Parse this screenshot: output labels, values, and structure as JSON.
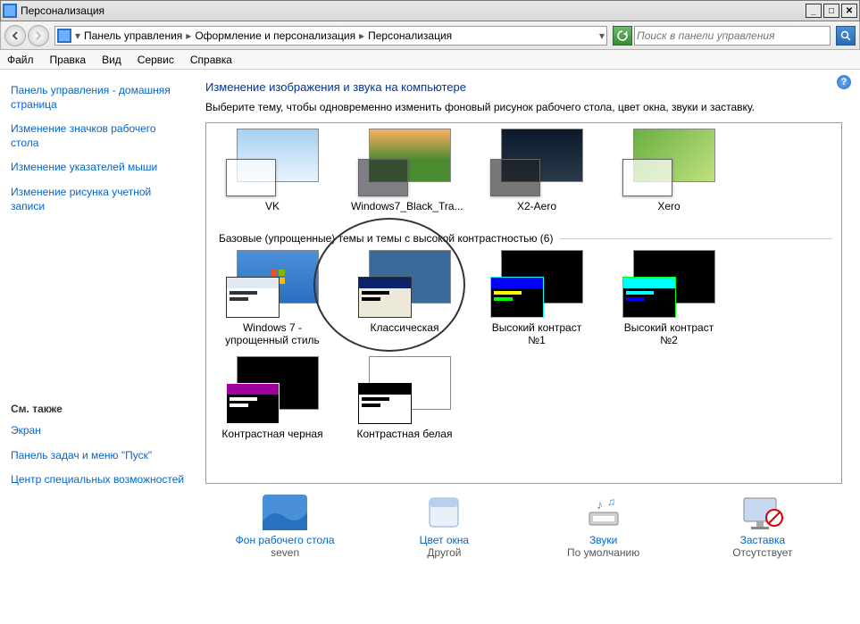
{
  "window": {
    "title": "Персонализация"
  },
  "breadcrumb": [
    "Панель управления",
    "Оформление и персонализация",
    "Персонализация"
  ],
  "search": {
    "placeholder": "Поиск в панели управления"
  },
  "menu": [
    "Файл",
    "Правка",
    "Вид",
    "Сервис",
    "Справка"
  ],
  "sidebar": {
    "links": [
      "Панель управления - домашняя страница",
      "Изменение значков рабочего стола",
      "Изменение указателей мыши",
      "Изменение рисунка учетной записи"
    ],
    "see_also_header": "См. также",
    "see_also": [
      "Экран",
      "Панель задач и меню \"Пуск\"",
      "Центр специальных возможностей"
    ]
  },
  "main": {
    "heading": "Изменение изображения и звука на компьютере",
    "subheading": "Выберите тему, чтобы одновременно изменить фоновый рисунок рабочего стола, цвет окна, звуки и заставку."
  },
  "theme_row1": [
    {
      "label": "VK",
      "bg": "bg-sky"
    },
    {
      "label": "Windows7_Black_Tra...",
      "bg": "bg-abstract"
    },
    {
      "label": "X2-Aero",
      "bg": "bg-dark"
    },
    {
      "label": "Xero",
      "bg": "bg-green"
    }
  ],
  "category_label": "Базовые (упрощенные) темы и темы с высокой контрастностью (6)",
  "theme_row2": [
    {
      "label": "Windows 7 - упрощенный стиль",
      "style": "win7"
    },
    {
      "label": "Классическая",
      "style": "classic"
    },
    {
      "label": "Высокий контраст №1",
      "style": "hc1"
    },
    {
      "label": "Высокий контраст №2",
      "style": "hc2"
    }
  ],
  "theme_row3": [
    {
      "label": "Контрастная черная",
      "style": "hcblack"
    },
    {
      "label": "Контрастная белая",
      "style": "hcwhite"
    }
  ],
  "bottom": [
    {
      "label": "Фон рабочего стола",
      "value": "seven"
    },
    {
      "label": "Цвет окна",
      "value": "Другой"
    },
    {
      "label": "Звуки",
      "value": "По умолчанию"
    },
    {
      "label": "Заставка",
      "value": "Отсутствует"
    }
  ]
}
